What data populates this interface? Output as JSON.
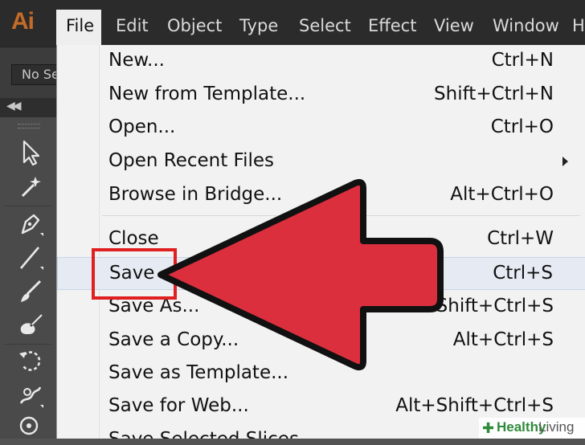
{
  "app": {
    "logo": "Ai"
  },
  "menubar": {
    "items": [
      "File",
      "Edit",
      "Object",
      "Type",
      "Select",
      "Effect",
      "View",
      "Window",
      "H"
    ]
  },
  "control_bar": {
    "selection_label": "No Se"
  },
  "tools": [
    {
      "icon": "selection-tool-icon"
    },
    {
      "icon": "magic-wand-icon"
    },
    {
      "icon": "pen-tool-icon"
    },
    {
      "icon": "line-segment-icon"
    },
    {
      "icon": "paintbrush-icon"
    },
    {
      "icon": "blob-brush-icon"
    },
    {
      "icon": "rotate-tool-icon"
    },
    {
      "icon": "warp-tool-icon"
    },
    {
      "icon": "symbol-sprayer-icon"
    }
  ],
  "file_menu": {
    "items": [
      {
        "label": "New...",
        "shortcut": "Ctrl+N"
      },
      {
        "label": "New from Template...",
        "shortcut": "Shift+Ctrl+N"
      },
      {
        "label": "Open...",
        "shortcut": "Ctrl+O"
      },
      {
        "label": "Open Recent Files",
        "shortcut": ""
      },
      {
        "label": "Browse in Bridge...",
        "shortcut": "Alt+Ctrl+O"
      },
      {
        "label": "Close",
        "shortcut": "Ctrl+W"
      },
      {
        "label": "Save",
        "shortcut": "Ctrl+S"
      },
      {
        "label": "Save As...",
        "shortcut": "Shift+Ctrl+S"
      },
      {
        "label": "Save a Copy...",
        "shortcut": "Alt+Ctrl+S"
      },
      {
        "label": "Save as Template...",
        "shortcut": ""
      },
      {
        "label": "Save for Web...",
        "shortcut": "Alt+Shift+Ctrl+S"
      },
      {
        "label": "Save Selected Slices...",
        "shortcut": ""
      }
    ],
    "highlighted": "Save"
  },
  "annotation": {
    "arrow_color": "#dc2f3e",
    "box_color": "#e02020"
  },
  "watermark": {
    "brand": "Healthy",
    "suffix": "Living"
  },
  "colors": {
    "menubar_bg": "#2b2b2b",
    "menu_bg": "#f2f2f2",
    "logo": "#c46b28"
  }
}
